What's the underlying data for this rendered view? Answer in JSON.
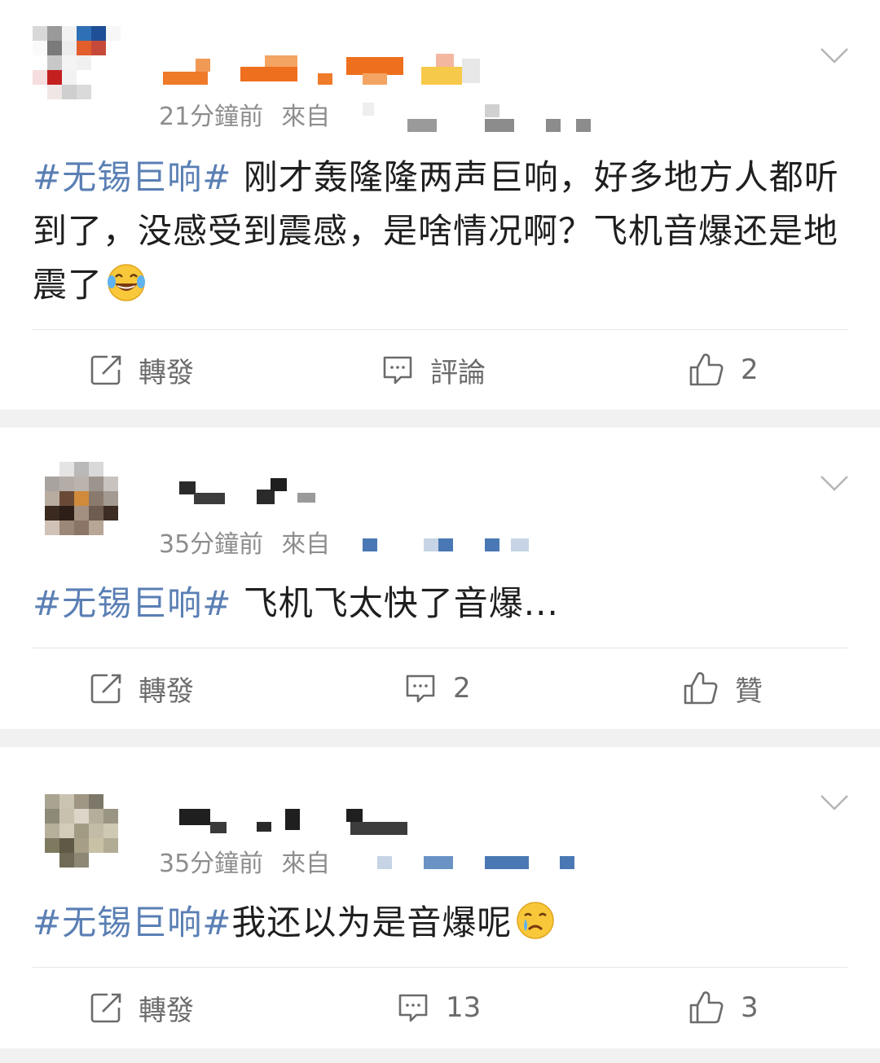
{
  "posts": [
    {
      "time": "21分鐘前",
      "from": "來自",
      "hashtag": "#无锡巨响#",
      "text": "刚才轰隆隆两声巨响，好多地方人都听到了，没感受到震感，是啥情况啊？飞机音爆还是地震了",
      "emoji": "laughing-tears",
      "repost_label": "轉發",
      "comment_label": "評論",
      "like_label": "2"
    },
    {
      "time": "35分鐘前",
      "from": "來自",
      "hashtag": "#无锡巨响#",
      "text": "飞机飞太快了音爆...",
      "repost_label": "轉發",
      "comment_label": "2",
      "like_label": "贊"
    },
    {
      "time": "35分鐘前",
      "from": "來自",
      "hashtag": "#无锡巨响#",
      "text": "我还以为是音爆呢",
      "emoji": "crying",
      "repost_label": "轉發",
      "comment_label": "13",
      "like_label": "3"
    }
  ],
  "colors": {
    "hashtag": "#5a7fb4",
    "meta": "#8d8d8d",
    "action": "#6b6b6b",
    "background": "#f1f1f1"
  },
  "icons": [
    "repost-icon",
    "comment-icon",
    "like-icon",
    "chevron-down-icon"
  ]
}
